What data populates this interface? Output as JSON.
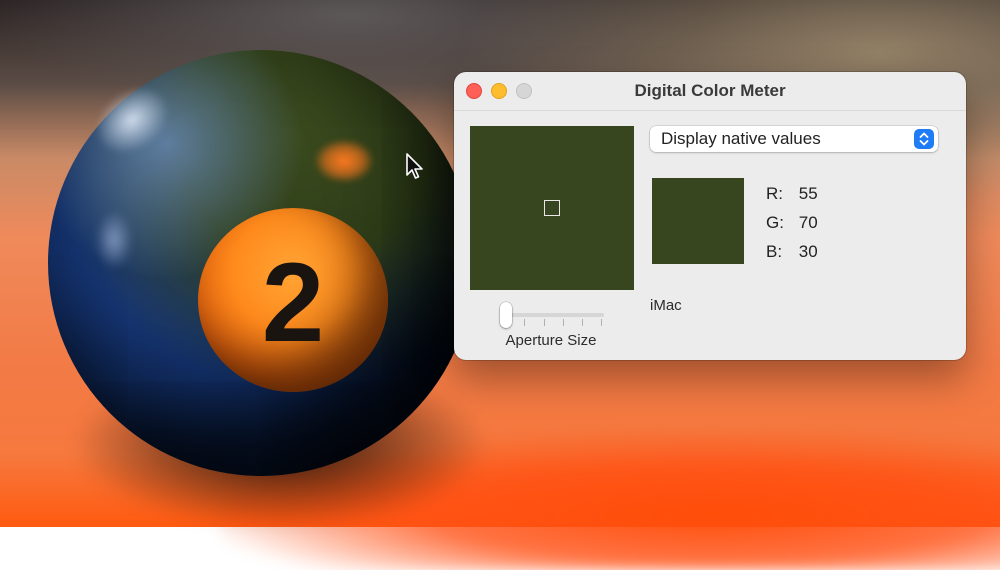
{
  "background": {
    "ball_number": "2"
  },
  "window": {
    "title": "Digital Color Meter",
    "traffic_lights": [
      "close",
      "minimize",
      "zoom"
    ],
    "dropdown": {
      "selected": "Display native values",
      "icon": "chevron-up-down-icon"
    },
    "sampled_color": "#37461e",
    "rgb": {
      "r_label": "R:",
      "r_value": "55",
      "g_label": "G:",
      "g_value": "70",
      "b_label": "B:",
      "b_value": "30"
    },
    "display_name": "iMac",
    "aperture": {
      "label": "Aperture Size",
      "level": 0
    }
  }
}
